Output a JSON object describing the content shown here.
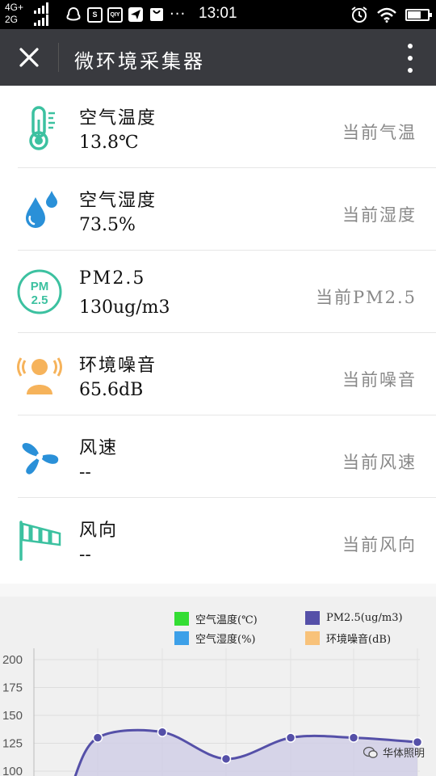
{
  "status_bar": {
    "network_top": "4G+",
    "network_bottom": "2G",
    "app_icons": [
      "S",
      "QIY"
    ],
    "dots": "···",
    "time": "13:01"
  },
  "title_bar": {
    "title": "微环境采集器"
  },
  "sensors": [
    {
      "name": "空气温度",
      "value": "13.8℃",
      "current_label": "当前气温",
      "icon": "thermometer-icon"
    },
    {
      "name": "空气湿度",
      "value": "73.5%",
      "current_label": "当前湿度",
      "icon": "water-drops-icon"
    },
    {
      "name": "PM2.5",
      "value": "130ug/m3",
      "current_label": "当前PM2.5",
      "icon": "pm25-icon"
    },
    {
      "name": "环境噪音",
      "value": "65.6dB",
      "current_label": "当前噪音",
      "icon": "noise-person-icon"
    },
    {
      "name": "风速",
      "value": "--",
      "current_label": "当前风速",
      "icon": "fan-icon"
    },
    {
      "name": "风向",
      "value": "--",
      "current_label": "当前风向",
      "icon": "windsock-icon"
    }
  ],
  "pm25_icon_text": {
    "top": "PM",
    "bottom": "2.5"
  },
  "chart_data": {
    "type": "line",
    "legend": [
      {
        "name": "空气温度(℃)",
        "color": "#33dd33"
      },
      {
        "name": "PM2.5(ug/m3)",
        "color": "#5550a8"
      },
      {
        "name": "空气湿度(%)",
        "color": "#3da0e8"
      },
      {
        "name": "环境噪音(dB)",
        "color": "#f8c27a"
      }
    ],
    "y_ticks": [
      200,
      175,
      150,
      125,
      100
    ],
    "ylim": [
      100,
      200
    ],
    "series": [
      {
        "name": "PM2.5(ug/m3)",
        "color": "#5550a8",
        "values": [
          90,
          130,
          135,
          111,
          130,
          130,
          126
        ]
      }
    ],
    "grid": true
  },
  "watermark": {
    "text": "华体照明"
  }
}
